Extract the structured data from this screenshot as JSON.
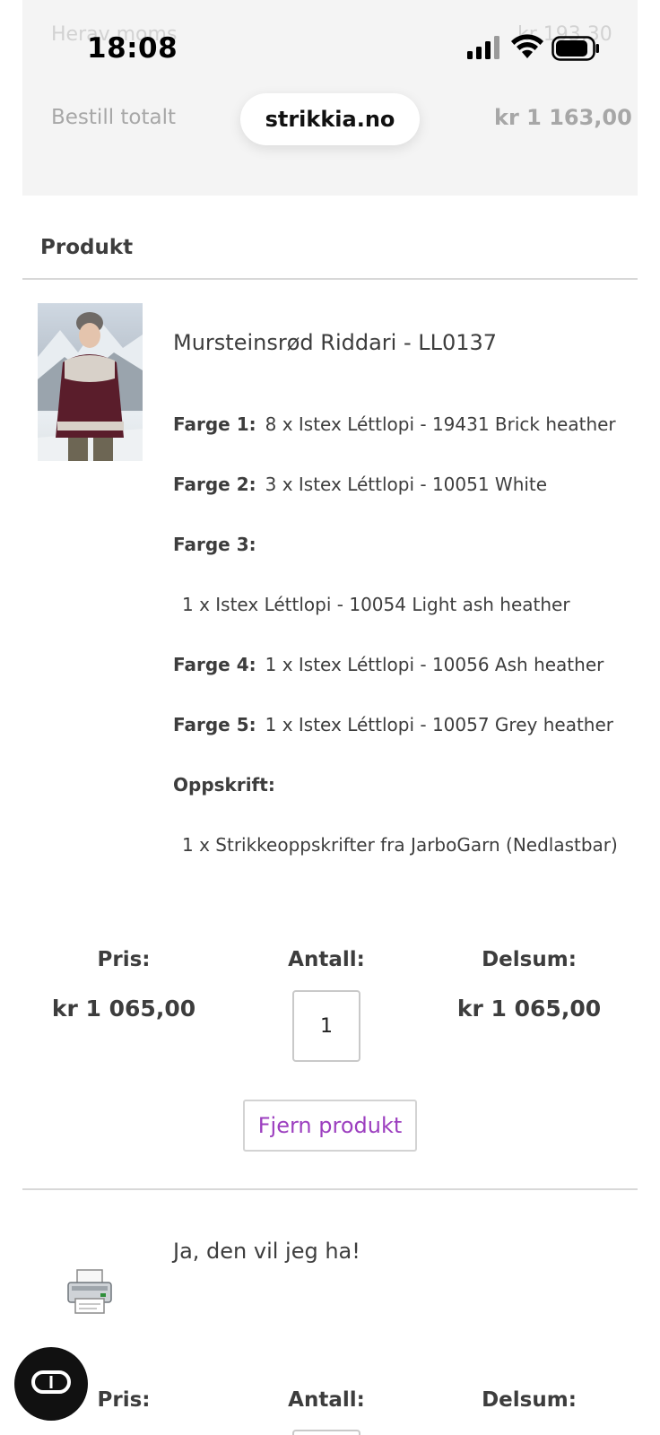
{
  "header": {
    "faded_label": "Herav moms",
    "faded_value": "kr 193,30",
    "status_time": "18:08",
    "total_label": "Bestill totalt",
    "url": "strikkia.no",
    "total_value": "kr 1 163,00"
  },
  "section_title": "Produkt",
  "product": {
    "name": "Mursteinsrød Riddari - LL0137",
    "specs": [
      {
        "label": "Farge 1:",
        "value": "8 x Istex Léttlopi - 19431 Brick heather"
      },
      {
        "label": "Farge 2:",
        "value": "3 x Istex Léttlopi - 10051 White"
      },
      {
        "label": "Farge 3:",
        "value": ""
      },
      {
        "label": "",
        "value": "1 x Istex Léttlopi - 10054 Light ash heather"
      },
      {
        "label": "Farge 4:",
        "value": "1 x Istex Léttlopi - 10056 Ash heather"
      },
      {
        "label": "Farge 5:",
        "value": "1 x Istex Léttlopi - 10057 Grey heather"
      },
      {
        "label": "Oppskrift:",
        "value": ""
      },
      {
        "label": "",
        "value": "1 x Strikkeoppskrifter fra JarboGarn (Nedlastbar)"
      }
    ],
    "price_label": "Pris:",
    "qty_label": "Antall:",
    "subtotal_label": "Delsum:",
    "price": "kr 1 065,00",
    "qty": "1",
    "subtotal": "kr 1 065,00",
    "remove_label": "Fjern produkt"
  },
  "addon": {
    "text": "Ja, den vil jeg ha!",
    "icon": "printer-icon",
    "price_label": "Pris:",
    "qty_label": "Antall:",
    "subtotal_label": "Delsum:"
  },
  "colors": {
    "accent": "#9c3fbf",
    "text": "#3d3d3d",
    "band": "#f4f4f4"
  }
}
